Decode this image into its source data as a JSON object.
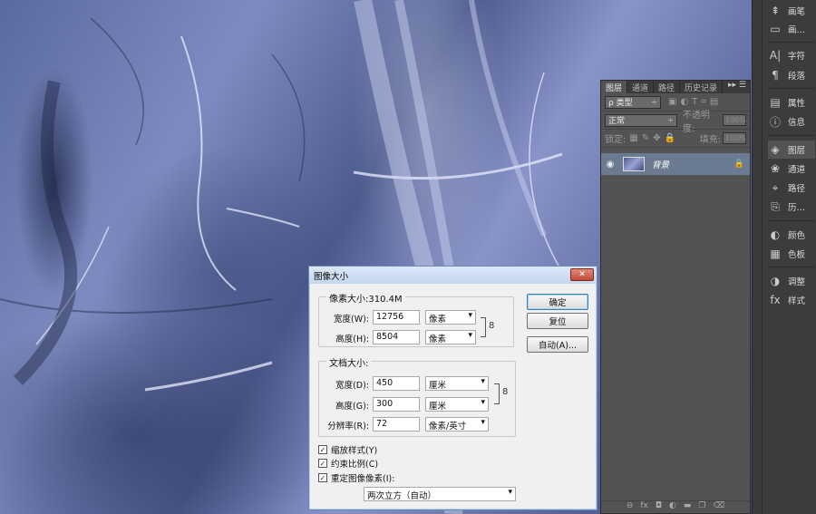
{
  "dock": {
    "items": [
      {
        "label": "画笔",
        "icon": "brush-icon",
        "glyph": "⇞"
      },
      {
        "label": "画…",
        "icon": "brush-presets-icon",
        "glyph": "▭"
      },
      {
        "label": "字符",
        "icon": "character-icon",
        "glyph": "A|"
      },
      {
        "label": "段落",
        "icon": "paragraph-icon",
        "glyph": "¶"
      },
      {
        "label": "属性",
        "icon": "properties-icon",
        "glyph": "▤"
      },
      {
        "label": "信息",
        "icon": "info-icon",
        "glyph": "ⓘ"
      },
      {
        "label": "图层",
        "icon": "layers-icon",
        "glyph": "◈"
      },
      {
        "label": "通道",
        "icon": "channels-icon",
        "glyph": "❀"
      },
      {
        "label": "路径",
        "icon": "paths-icon",
        "glyph": "⌖"
      },
      {
        "label": "历…",
        "icon": "history-icon",
        "glyph": "⎘"
      },
      {
        "label": "颜色",
        "icon": "color-icon",
        "glyph": "◐"
      },
      {
        "label": "色板",
        "icon": "swatches-icon",
        "glyph": "▦"
      },
      {
        "label": "调整",
        "icon": "adjustments-icon",
        "glyph": "◑"
      },
      {
        "label": "样式",
        "icon": "styles-icon",
        "glyph": "fx"
      }
    ]
  },
  "layers_panel": {
    "tabs": [
      "图层",
      "通道",
      "路径",
      "历史记录"
    ],
    "filter_label": "ρ 类型",
    "blend_mode": "正常",
    "opacity_label": "不透明度:",
    "opacity_value": "100%",
    "lock_label": "锁定:",
    "fill_label": "填充:",
    "fill_value": "100%",
    "layer_name": "背景"
  },
  "dialog": {
    "title": "图像大小",
    "pixel_size_label": "像素大小:310.4M",
    "width_px_label": "宽度(W):",
    "width_px_value": "12756",
    "width_px_unit": "像素",
    "height_px_label": "高度(H):",
    "height_px_value": "8504",
    "height_px_unit": "像素",
    "doc_size_label": "文档大小:",
    "width_doc_label": "宽度(D):",
    "width_doc_value": "450",
    "width_doc_unit": "厘米",
    "height_doc_label": "高度(G):",
    "height_doc_value": "300",
    "height_doc_unit": "厘米",
    "resolution_label": "分辨率(R):",
    "resolution_value": "72",
    "resolution_unit": "像素/英寸",
    "ok_button": "确定",
    "reset_button": "复位",
    "auto_button": "自动(A)...",
    "scale_styles": "缩放样式(Y)",
    "constrain": "约束比例(C)",
    "resample": "重定图像像素(I):",
    "resample_method": "两次立方（自动）",
    "check_glyph": "✓"
  }
}
